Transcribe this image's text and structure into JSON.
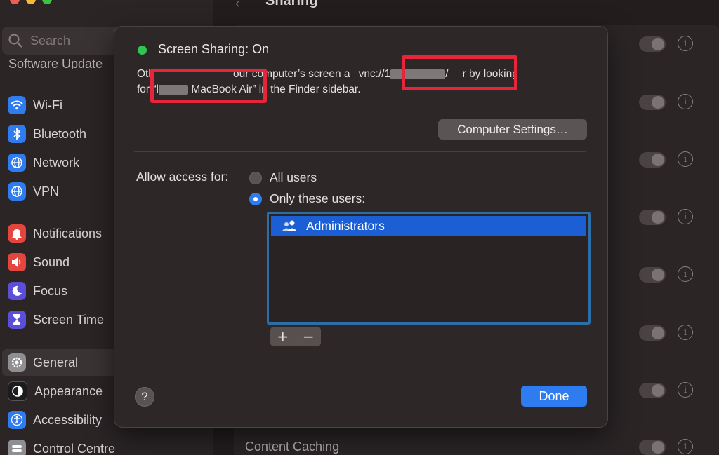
{
  "window": {
    "title": "Sharing"
  },
  "sidebar": {
    "search_placeholder": "Search",
    "partial_item": "Software Update",
    "items": [
      {
        "label": "Wi-Fi",
        "icon": "wifi-icon",
        "color": "#2f7bf0"
      },
      {
        "label": "Bluetooth",
        "icon": "bluetooth-icon",
        "color": "#2f7bf0"
      },
      {
        "label": "Network",
        "icon": "globe-icon",
        "color": "#2f7bf0"
      },
      {
        "label": "VPN",
        "icon": "vpn-globe-icon",
        "color": "#2f7bf0"
      },
      {
        "label": "Notifications",
        "icon": "bell-icon",
        "color": "#e4463f"
      },
      {
        "label": "Sound",
        "icon": "speaker-icon",
        "color": "#e4463f"
      },
      {
        "label": "Focus",
        "icon": "moon-icon",
        "color": "#5b4fd8"
      },
      {
        "label": "Screen Time",
        "icon": "hourglass-icon",
        "color": "#5b4fd8"
      },
      {
        "label": "General",
        "icon": "gear-icon",
        "color": "#8e8e93",
        "selected": true
      },
      {
        "label": "Appearance",
        "icon": "appearance-icon",
        "color": "#1c1c1e"
      },
      {
        "label": "Accessibility",
        "icon": "accessibility-icon",
        "color": "#2f7bf0"
      },
      {
        "label": "Control Centre",
        "icon": "control-centre-icon",
        "color": "#8e8e93"
      }
    ]
  },
  "content": {
    "partial_row": "Content Caching"
  },
  "dialog": {
    "status": "Screen Sharing: On",
    "status_color": "#30c553",
    "desc_line1_a": "Oth",
    "desc_line1_b": "our computer’s screen a",
    "desc_vnc_prefix": "vnc://1",
    "desc_vnc_suffix": "/",
    "desc_line1_c": "r by looking",
    "desc_line2_a": "for “l",
    "desc_device": "MacBook Air",
    "desc_line2_b": "” in the Finder sidebar.",
    "settings_button": "Computer Settings…",
    "allow_label": "Allow access for:",
    "option_all": "All users",
    "option_only": "Only these users:",
    "selected_option": "Only these users:",
    "users": [
      "Administrators"
    ],
    "add_button": "+",
    "remove_button": "−",
    "help_button": "?",
    "done_button": "Done",
    "highlight_color": "#e8243b",
    "accent_color": "#2f7bf0"
  }
}
